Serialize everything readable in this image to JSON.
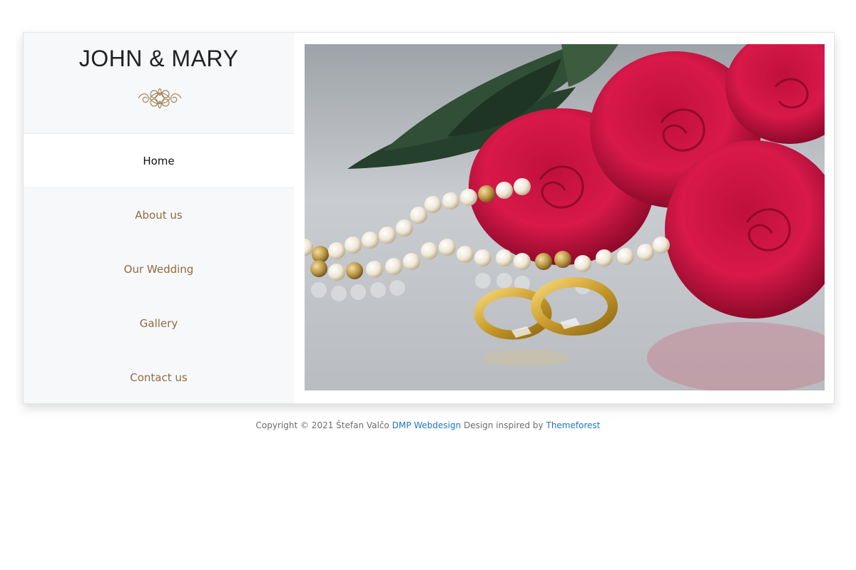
{
  "brand": {
    "title": "JOHN & MARY"
  },
  "nav": {
    "items": [
      {
        "label": "Home",
        "active": true
      },
      {
        "label": "About us",
        "active": false
      },
      {
        "label": "Our Wedding",
        "active": false
      },
      {
        "label": "Gallery",
        "active": false
      },
      {
        "label": "Contact us",
        "active": false
      }
    ]
  },
  "hero": {
    "icon": "wedding-rings-roses-pearls-photo"
  },
  "footer": {
    "text_1": "Copyright © 2021 Štefan Valčo",
    "link_1": "DMP Webdesign",
    "text_2": "Design inspired by",
    "link_2": "Themeforest"
  },
  "colors": {
    "nav_link": "#8d6c3f",
    "nav_active": "#111111",
    "sidebar_bg": "#f7f8fa",
    "ornament": "#a5865a",
    "footer_link": "#1f73c9"
  }
}
